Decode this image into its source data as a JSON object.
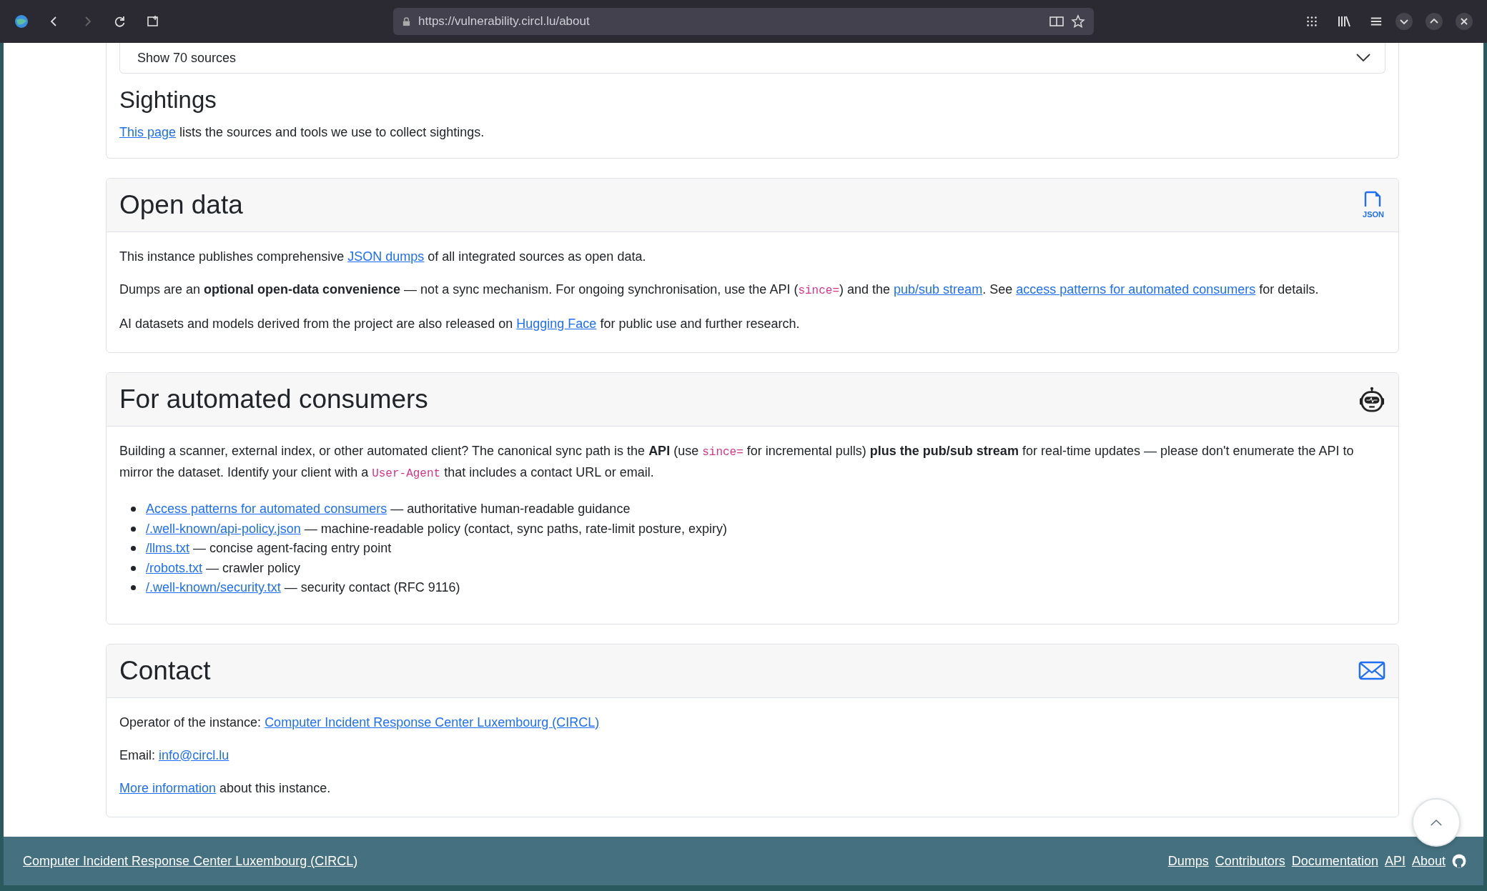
{
  "browser": {
    "url": "https://vulnerability.circl.lu/about",
    "forward_disabled": true
  },
  "sources_card": {
    "expander": {
      "label": "Show 70 sources",
      "expanded": false
    },
    "heading": "Sightings",
    "paragraph": [
      {
        "kind": "link",
        "text": "This page"
      },
      {
        "kind": "text",
        "text": " lists the sources and tools we use to collect sightings."
      }
    ]
  },
  "sections": [
    {
      "title": "Open data",
      "kind": "json",
      "icon_label": "JSON",
      "paragraphs": [
        [
          {
            "kind": "text",
            "text": "This instance publishes comprehensive "
          },
          {
            "kind": "link",
            "text": "JSON dumps"
          },
          {
            "kind": "text",
            "text": " of all integrated sources as open data."
          }
        ],
        [
          {
            "kind": "text",
            "text": "Dumps are an "
          },
          {
            "kind": "bold",
            "text": "optional open-data convenience"
          },
          {
            "kind": "text",
            "text": " — not a sync mechanism. For ongoing synchronisation, use the API ("
          },
          {
            "kind": "code",
            "text": "since="
          },
          {
            "kind": "text",
            "text": ") and the "
          },
          {
            "kind": "link",
            "text": "pub/sub stream"
          },
          {
            "kind": "text",
            "text": ". See "
          },
          {
            "kind": "link",
            "text": "access patterns for automated consumers"
          },
          {
            "kind": "text",
            "text": " for details."
          }
        ],
        [
          {
            "kind": "text",
            "text": "AI datasets and models derived from the project are also released on "
          },
          {
            "kind": "link",
            "text": "Hugging Face"
          },
          {
            "kind": "text",
            "text": " for public use and further research."
          }
        ]
      ]
    },
    {
      "title": "For automated consumers",
      "kind": "robot",
      "paragraphs": [
        [
          {
            "kind": "text",
            "text": "Building a scanner, external index, or other automated client? The canonical sync path is the "
          },
          {
            "kind": "bold",
            "text": "API"
          },
          {
            "kind": "text",
            "text": " (use "
          },
          {
            "kind": "code",
            "text": "since="
          },
          {
            "kind": "text",
            "text": " for incremental pulls) "
          },
          {
            "kind": "bold",
            "text": "plus the pub/sub stream"
          },
          {
            "kind": "text",
            "text": " for real-time updates — please don't enumerate the API to mirror the dataset. Identify your client with a "
          },
          {
            "kind": "code",
            "text": "User-Agent"
          },
          {
            "kind": "text",
            "text": " that includes a contact URL or email."
          }
        ]
      ],
      "bullets": [
        {
          "link": "Access patterns for automated consumers",
          "text": " — authoritative human-readable guidance"
        },
        {
          "link": "/.well-known/api-policy.json",
          "text": " — machine-readable policy (contact, sync paths, rate-limit posture, expiry)"
        },
        {
          "link": "/llms.txt",
          "text": " — concise agent-facing entry point"
        },
        {
          "link": "/robots.txt",
          "text": " — crawler policy"
        },
        {
          "link": "/.well-known/security.txt",
          "text": " — security contact (RFC 9116)"
        }
      ]
    },
    {
      "title": "Contact",
      "kind": "mail",
      "paragraphs": [
        [
          {
            "kind": "text",
            "text": "Operator of the instance: "
          },
          {
            "kind": "link",
            "text": "Computer Incident Response Center Luxembourg (CIRCL)"
          }
        ],
        [
          {
            "kind": "text",
            "text": "Email: "
          },
          {
            "kind": "link",
            "text": "info@circl.lu"
          }
        ],
        [
          {
            "kind": "link",
            "text": "More information"
          },
          {
            "kind": "text",
            "text": " about this instance."
          }
        ]
      ]
    }
  ],
  "footer": {
    "left_link": "Computer Incident Response Center Luxembourg (CIRCL)",
    "links": [
      "Dumps",
      "Contributors",
      "Documentation",
      "API",
      "About"
    ]
  }
}
